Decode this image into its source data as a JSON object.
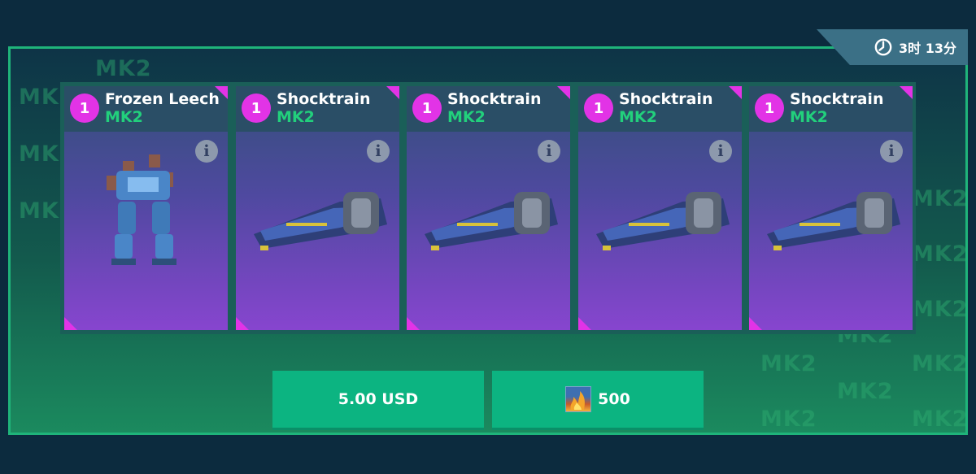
{
  "timer": {
    "hours": "3",
    "hours_unit": "时",
    "minutes": "13",
    "minutes_unit": "分"
  },
  "watermark_text": "MK2",
  "cards": [
    {
      "count": "1",
      "name": "Frozen Leech",
      "level": "MK2",
      "kind": "robot",
      "info_icon": "i"
    },
    {
      "count": "1",
      "name": "Shocktrain",
      "level": "MK2",
      "kind": "weapon",
      "info_icon": "i"
    },
    {
      "count": "1",
      "name": "Shocktrain",
      "level": "MK2",
      "kind": "weapon",
      "info_icon": "i"
    },
    {
      "count": "1",
      "name": "Shocktrain",
      "level": "MK2",
      "kind": "weapon",
      "info_icon": "i"
    },
    {
      "count": "1",
      "name": "Shocktrain",
      "level": "MK2",
      "kind": "weapon",
      "info_icon": "i"
    }
  ],
  "buttons": {
    "usd_label": "5.00 USD",
    "currency_amount": "500",
    "currency_icon": "fire-currency-icon"
  },
  "colors": {
    "accent_green": "#1fb47a",
    "badge_magenta": "#e233e6",
    "button_green": "#0cb481"
  }
}
